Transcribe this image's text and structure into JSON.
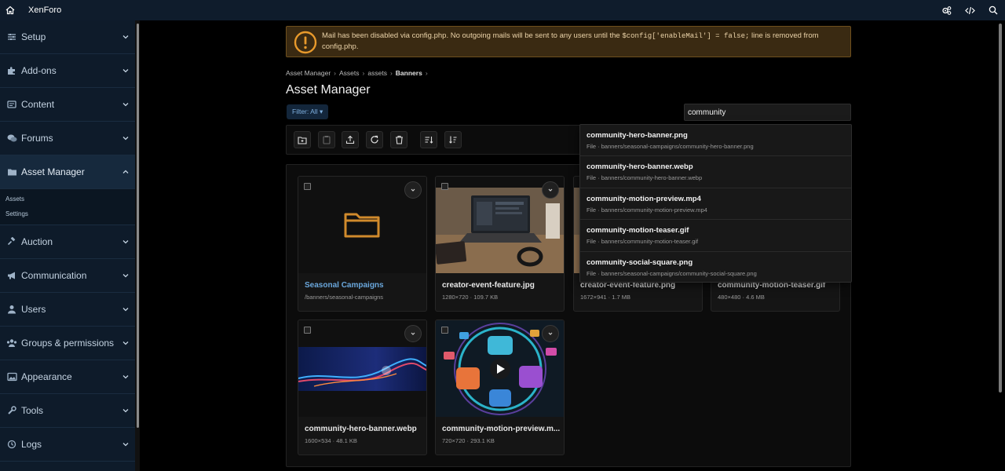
{
  "topbar": {
    "brand": "XenForo"
  },
  "sidebar": {
    "items": [
      {
        "label": "Setup",
        "name": "setup"
      },
      {
        "label": "Add-ons",
        "name": "add-ons"
      },
      {
        "label": "Content",
        "name": "content"
      },
      {
        "label": "Forums",
        "name": "forums"
      },
      {
        "label": "Asset Manager",
        "name": "asset-manager"
      },
      {
        "label": "Auction",
        "name": "auction"
      },
      {
        "label": "Communication",
        "name": "communication"
      },
      {
        "label": "Users",
        "name": "users"
      },
      {
        "label": "Groups & permissions",
        "name": "groups-permissions"
      },
      {
        "label": "Appearance",
        "name": "appearance"
      },
      {
        "label": "Tools",
        "name": "tools"
      },
      {
        "label": "Logs",
        "name": "logs"
      }
    ],
    "asset_sub": [
      "Assets",
      "Settings"
    ]
  },
  "alert": {
    "text_before": "Mail has been disabled via config.php. No outgoing mails will be sent to any users until the ",
    "code": "$config['enableMail'] = false;",
    "text_after": " line is removed from config.php."
  },
  "breadcrumb": [
    "Asset Manager",
    "Assets",
    "assets",
    "Banners"
  ],
  "page_title": "Asset Manager",
  "filter_label": "Filter: All ▾",
  "search": {
    "value": "community"
  },
  "cards": [
    {
      "name": "Seasonal Campaigns",
      "meta": "/banners/seasonal-campaigns"
    },
    {
      "name": "creator-event-feature.jpg",
      "meta": "1280×720 · 109.7 KB"
    },
    {
      "name": "creator-event-feature.png",
      "meta": "1672×941 · 1.7 MB"
    },
    {
      "name": "community-motion-teaser.gif",
      "meta": "480×480 · 4.6 MB"
    },
    {
      "name": "community-hero-banner.webp",
      "meta": "1600×534 · 48.1 KB"
    },
    {
      "name": "community-motion-preview.m...",
      "meta": "720×720 · 293.1 KB"
    }
  ],
  "suggestions": [
    {
      "title": "community-hero-banner.png",
      "sub": "File · banners/seasonal-campaigns/community-hero-banner.png"
    },
    {
      "title": "community-hero-banner.webp",
      "sub": "File · banners/community-hero-banner.webp"
    },
    {
      "title": "community-motion-preview.mp4",
      "sub": "File · banners/community-motion-preview.mp4"
    },
    {
      "title": "community-motion-teaser.gif",
      "sub": "File · banners/community-motion-teaser.gif"
    },
    {
      "title": "community-social-square.png",
      "sub": "File · banners/seasonal-campaigns/community-social-square.png"
    }
  ],
  "colors": {
    "accent": "#6aa7dc",
    "sidebar_bg": "#0e1b2a",
    "alert_bg": "#3a2a12",
    "folder": "#d08a2c"
  }
}
